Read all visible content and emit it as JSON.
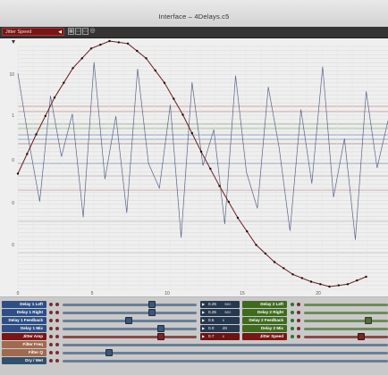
{
  "window": {
    "title": "Interface – 4Delays.c5"
  },
  "toolbar": {
    "param_selected": "Jitter Speed",
    "icons": [
      "grid-icon",
      "copy-icon",
      "paste-icon",
      "eye-icon"
    ]
  },
  "plot": {
    "x_ticks": [
      "0",
      "5",
      "10",
      "15",
      "20"
    ],
    "y_ticks": [
      "10",
      "1",
      "0",
      "0",
      "0"
    ],
    "colors": {
      "curve": "#6b1d1d",
      "noise": "#3e4e7a"
    }
  },
  "chart_data": {
    "type": "line",
    "series": [
      {
        "values": [
          {
            "x": 0,
            "y": 0.46
          },
          {
            "x": 1,
            "y": 0.62
          },
          {
            "x": 2,
            "y": 0.77
          },
          {
            "x": 3,
            "y": 0.89
          },
          {
            "x": 4,
            "y": 0.97
          },
          {
            "x": 5,
            "y": 1.0
          },
          {
            "x": 6,
            "y": 0.99
          },
          {
            "x": 7,
            "y": 0.93
          },
          {
            "x": 8,
            "y": 0.83
          },
          {
            "x": 9,
            "y": 0.7
          },
          {
            "x": 10,
            "y": 0.55
          },
          {
            "x": 11,
            "y": 0.41
          },
          {
            "x": 12,
            "y": 0.28
          },
          {
            "x": 13,
            "y": 0.17
          },
          {
            "x": 14,
            "y": 0.1
          },
          {
            "x": 15,
            "y": 0.05
          },
          {
            "x": 16,
            "y": 0.02
          },
          {
            "x": 17,
            "y": 0.0
          },
          {
            "x": 18,
            "y": 0.01
          },
          {
            "x": 19,
            "y": 0.04
          }
        ]
      },
      {
        "values": [
          0.92,
          0.62,
          0.35,
          0.82,
          0.55,
          0.74,
          0.28,
          0.97,
          0.45,
          0.73,
          0.3,
          0.94,
          0.52,
          0.41,
          0.78,
          0.19,
          0.88,
          0.51,
          0.67,
          0.25,
          0.91,
          0.48,
          0.32,
          0.86,
          0.59,
          0.22,
          0.76,
          0.43,
          0.95,
          0.37,
          0.63,
          0.18,
          0.84,
          0.5,
          0.71
        ]
      }
    ]
  },
  "controls": {
    "left": [
      {
        "label": "Delay 1 Left",
        "value": "0.26",
        "unit": "sec"
      },
      {
        "label": "Delay 1 Right",
        "value": "0.25",
        "unit": "sec"
      },
      {
        "label": "Delay 1 Feedback",
        "value": "0.5",
        "unit": "x"
      },
      {
        "label": "Delay 1 Mix",
        "value": "0.0",
        "unit": "dB"
      },
      {
        "label": "Jitter Amp",
        "value": "0.7",
        "unit": "x"
      },
      {
        "label": "Filter Freq"
      },
      {
        "label": "Filter Q"
      },
      {
        "label": "Dry / Wet"
      }
    ],
    "right": [
      {
        "label": "Delay 2 Left"
      },
      {
        "label": "Delay 2 Right"
      },
      {
        "label": "Delay 2 Feedback"
      },
      {
        "label": "Delay 2 Mix"
      },
      {
        "label": "Jitter Speed"
      }
    ]
  }
}
